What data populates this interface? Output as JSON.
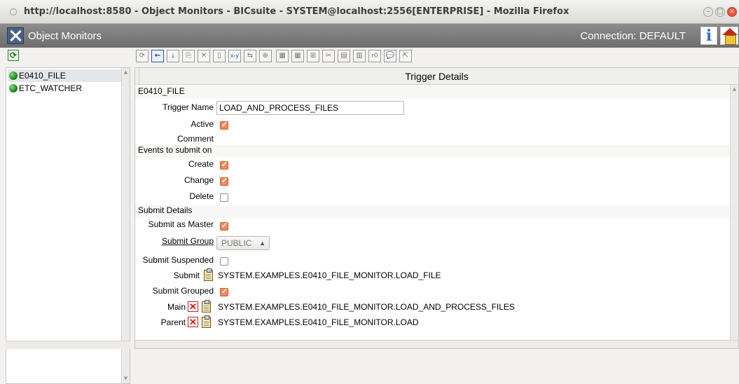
{
  "window": {
    "title": "http://localhost:8580 - Object Monitors - BICsuite - SYSTEM@localhost:2556[ENTERPRISE] - Mozilla Firefox",
    "min": "–",
    "max": "□",
    "close": "×"
  },
  "app": {
    "title": "Object Monitors",
    "connection": "Connection: DEFAULT",
    "info": "i"
  },
  "tree": {
    "items": [
      {
        "label": "E0410_FILE",
        "selected": true
      },
      {
        "label": "ETC_WATCHER",
        "selected": false
      }
    ]
  },
  "toolbar": {
    "buttons": [
      "⟳",
      "←",
      "⤓",
      "⎘",
      "✕",
      "▯",
      "x-y",
      "⇆",
      "⊕",
      "▦",
      "▦",
      "⊞",
      "✂",
      "▤",
      "▥",
      "r0",
      "💬",
      "⇱"
    ]
  },
  "panel": {
    "header": "Trigger Details",
    "object_name": "E0410_FILE",
    "trigger_name_label": "Trigger Name",
    "trigger_name_value": "LOAD_AND_PROCESS_FILES",
    "active_label": "Active",
    "active": true,
    "comment_label": "Comment",
    "events_section": "Events to submit on",
    "create_label": "Create",
    "create": true,
    "change_label": "Change",
    "change": true,
    "delete_label": "Delete",
    "delete": false,
    "submit_details_section": "Submit Details",
    "submit_as_master_label": "Submit as Master",
    "submit_as_master": true,
    "submit_group_label": "Submit Group",
    "submit_group_value": "PUBLIC",
    "submit_suspended_label": "Submit Suspended",
    "submit_suspended": false,
    "submit_label": "Submit",
    "submit_value": "SYSTEM.EXAMPLES.E0410_FILE_MONITOR.LOAD_FILE",
    "submit_grouped_label": "Submit Grouped",
    "submit_grouped": true,
    "main_label": "Main",
    "main_value": "SYSTEM.EXAMPLES.E0410_FILE_MONITOR.LOAD_AND_PROCESS_FILES",
    "parent_label": "Parent",
    "parent_value": "SYSTEM.EXAMPLES.E0410_FILE_MONITOR.LOAD"
  }
}
